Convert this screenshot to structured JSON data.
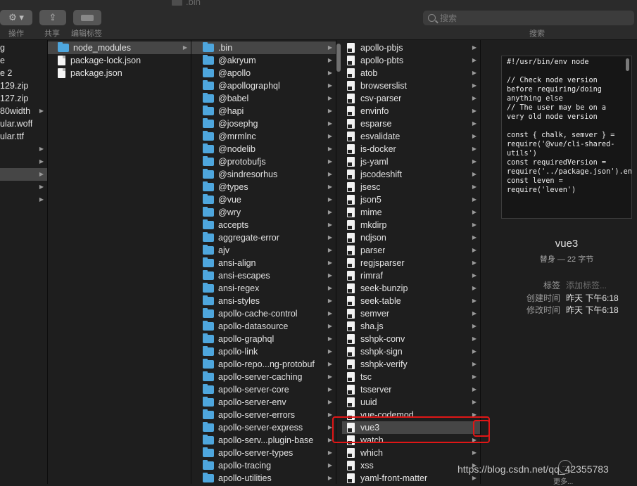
{
  "window": {
    "title": ".bin"
  },
  "toolbar": {
    "action_label": "操作",
    "share_label": "共享",
    "tags_label": "编辑标签",
    "search_placeholder": "搜索",
    "search_label": "搜索"
  },
  "col1": {
    "items": [
      {
        "name": "g",
        "chevron": false
      },
      {
        "name": "e",
        "chevron": false
      },
      {
        "name": "e 2",
        "chevron": false
      },
      {
        "name": "129.zip",
        "chevron": false
      },
      {
        "name": "127.zip",
        "chevron": false
      },
      {
        "name": "80width",
        "chevron": true
      },
      {
        "name": "ular.woff",
        "chevron": false
      },
      {
        "name": "ular.ttf",
        "chevron": false
      },
      {
        "name": "",
        "chevron": true
      },
      {
        "name": "",
        "chevron": true
      },
      {
        "name": "",
        "chevron": true,
        "selected": true
      },
      {
        "name": "",
        "chevron": true
      },
      {
        "name": "",
        "chevron": true
      }
    ]
  },
  "col2": {
    "items": [
      {
        "name": "node_modules",
        "type": "folder",
        "chevron": true,
        "selected": true
      },
      {
        "name": "package-lock.json",
        "type": "doc",
        "chevron": false
      },
      {
        "name": "package.json",
        "type": "doc",
        "chevron": false
      }
    ]
  },
  "col3": {
    "items": [
      {
        "name": ".bin",
        "selected": true
      },
      {
        "name": "@akryum"
      },
      {
        "name": "@apollo"
      },
      {
        "name": "@apollographql"
      },
      {
        "name": "@babel"
      },
      {
        "name": "@hapi"
      },
      {
        "name": "@josephg"
      },
      {
        "name": "@mrmlnc"
      },
      {
        "name": "@nodelib"
      },
      {
        "name": "@protobufjs"
      },
      {
        "name": "@sindresorhus"
      },
      {
        "name": "@types"
      },
      {
        "name": "@vue"
      },
      {
        "name": "@wry"
      },
      {
        "name": "accepts"
      },
      {
        "name": "aggregate-error"
      },
      {
        "name": "ajv"
      },
      {
        "name": "ansi-align"
      },
      {
        "name": "ansi-escapes"
      },
      {
        "name": "ansi-regex"
      },
      {
        "name": "ansi-styles"
      },
      {
        "name": "apollo-cache-control"
      },
      {
        "name": "apollo-datasource"
      },
      {
        "name": "apollo-graphql"
      },
      {
        "name": "apollo-link"
      },
      {
        "name": "apollo-repo...ng-protobuf"
      },
      {
        "name": "apollo-server-caching"
      },
      {
        "name": "apollo-server-core"
      },
      {
        "name": "apollo-server-env"
      },
      {
        "name": "apollo-server-errors"
      },
      {
        "name": "apollo-server-express"
      },
      {
        "name": "apollo-serv...plugin-base"
      },
      {
        "name": "apollo-server-types"
      },
      {
        "name": "apollo-tracing"
      },
      {
        "name": "apollo-utilities"
      }
    ]
  },
  "col4": {
    "items": [
      {
        "name": "apollo-pbjs",
        "chevron": true
      },
      {
        "name": "apollo-pbts",
        "chevron": true
      },
      {
        "name": "atob",
        "chevron": true
      },
      {
        "name": "browserslist",
        "chevron": true
      },
      {
        "name": "csv-parser",
        "chevron": true
      },
      {
        "name": "envinfo",
        "chevron": true
      },
      {
        "name": "esparse",
        "chevron": true
      },
      {
        "name": "esvalidate",
        "chevron": true
      },
      {
        "name": "is-docker",
        "chevron": true
      },
      {
        "name": "js-yaml",
        "chevron": true
      },
      {
        "name": "jscodeshift",
        "chevron": true
      },
      {
        "name": "jsesc",
        "chevron": true
      },
      {
        "name": "json5",
        "chevron": true
      },
      {
        "name": "mime",
        "chevron": true
      },
      {
        "name": "mkdirp",
        "chevron": true
      },
      {
        "name": "ndjson",
        "chevron": true
      },
      {
        "name": "parser",
        "chevron": true
      },
      {
        "name": "regjsparser",
        "chevron": true
      },
      {
        "name": "rimraf",
        "chevron": true
      },
      {
        "name": "seek-bunzip",
        "chevron": true
      },
      {
        "name": "seek-table",
        "chevron": true
      },
      {
        "name": "semver",
        "chevron": true
      },
      {
        "name": "sha.js",
        "chevron": true
      },
      {
        "name": "sshpk-conv",
        "chevron": true
      },
      {
        "name": "sshpk-sign",
        "chevron": true
      },
      {
        "name": "sshpk-verify",
        "chevron": true
      },
      {
        "name": "tsc",
        "chevron": true
      },
      {
        "name": "tsserver",
        "chevron": true
      },
      {
        "name": "uuid",
        "chevron": true
      },
      {
        "name": "vue-codemod",
        "chevron": true
      },
      {
        "name": "vue3",
        "chevron": false,
        "selected": true
      },
      {
        "name": "watch",
        "chevron": true
      },
      {
        "name": "which",
        "chevron": true
      },
      {
        "name": "xss",
        "chevron": true
      },
      {
        "name": "yaml-front-matter",
        "chevron": true
      }
    ]
  },
  "preview": {
    "code": "#!/usr/bin/env node\n\n// Check node version before requiring/doing anything else\n// The user may be on a very old node version\n\nconst { chalk, semver } = require('@vue/cli-shared-utils')\nconst requiredVersion = require('../package.json').engines.node\nconst leven = require('leven')"
  },
  "info": {
    "name": "vue3",
    "kind": "替身 — 22 字节",
    "rows": [
      {
        "key": "标签",
        "value": "添加标签...",
        "placeholder": true
      },
      {
        "key": "创建时间",
        "value": "昨天 下午6:18",
        "placeholder": false
      },
      {
        "key": "修改时间",
        "value": "昨天 下午6:18",
        "placeholder": false
      }
    ],
    "more_label": "更多..."
  },
  "watermark": "https://blog.csdn.net/qq_42355783",
  "colors": {
    "highlight": "#e01616",
    "folder": "#4ea6dd",
    "selected_row": "#464646"
  }
}
